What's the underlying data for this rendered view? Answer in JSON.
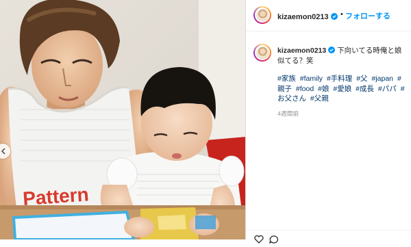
{
  "post": {
    "username": "kizaemon0213",
    "dot": "•",
    "follow_label": "フォローする",
    "caption_text": "下向いてる時俺と娘似てる？笑",
    "hashtags": [
      "#家族",
      "#family",
      "#手料理",
      "#父",
      "#japan",
      "#親子",
      "#food",
      "#娘",
      "#愛娘",
      "#成長",
      "#パパ",
      "#お父さん",
      "#父親"
    ],
    "time_ago": "4週間前"
  },
  "photo": {
    "shirt_print": "Pattern"
  },
  "colors": {
    "link_blue": "#0095f6",
    "hashtag_blue": "#00376b",
    "muted_gray": "#8e8e8e",
    "text": "#262626"
  },
  "icons": {
    "verified": "verified-badge-icon",
    "carousel_prev": "chevron-left-icon",
    "like": "heart-icon",
    "comment": "comment-icon"
  }
}
